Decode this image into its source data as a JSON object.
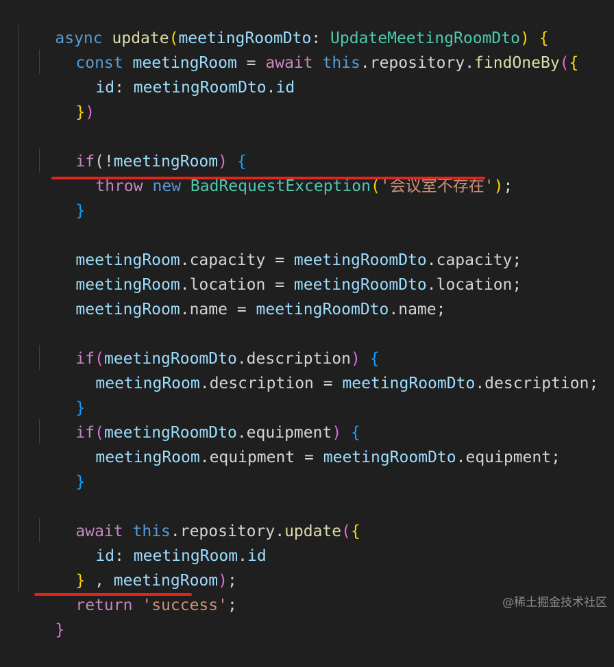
{
  "code": {
    "l1": [
      "async",
      "update",
      "(",
      "meetingRoomDto",
      ": ",
      "UpdateMeetingRoomDto",
      ")",
      " {"
    ],
    "l2": [
      "const",
      "meetingRoom",
      " = ",
      "await",
      "this",
      ".repository.",
      "findOneBy",
      "(",
      "{"
    ],
    "l3": [
      "id",
      ": ",
      "meetingRoomDto",
      ".",
      "id"
    ],
    "l4": [
      "}",
      ")"
    ],
    "l6": [
      "if",
      "(!",
      "meetingRoom",
      ")",
      " {"
    ],
    "l7": [
      "throw",
      "new",
      "BadRequestException",
      "(",
      "'会议室不存在'",
      ")",
      ";"
    ],
    "l8": [
      "}"
    ],
    "l10": [
      "meetingRoom",
      ".capacity",
      " = ",
      "meetingRoomDto",
      ".capacity",
      ";"
    ],
    "l11": [
      "meetingRoom",
      ".location",
      " = ",
      "meetingRoomDto",
      ".location",
      ";"
    ],
    "l12": [
      "meetingRoom",
      ".name",
      " = ",
      "meetingRoomDto",
      ".name",
      ";"
    ],
    "l14": [
      "if",
      "(",
      "meetingRoomDto",
      ".description",
      ")",
      " {"
    ],
    "l15": [
      "meetingRoom",
      ".description",
      " = ",
      "meetingRoomDto",
      ".description",
      ";"
    ],
    "l16": [
      "}"
    ],
    "l17": [
      "if",
      "(",
      "meetingRoomDto",
      ".equipment",
      ")",
      " {"
    ],
    "l18": [
      "meetingRoom",
      ".equipment",
      " = ",
      "meetingRoomDto",
      ".equipment",
      ";"
    ],
    "l19": [
      "}"
    ],
    "l21": [
      "await",
      "this",
      ".repository.",
      "update",
      "(",
      "{"
    ],
    "l22": [
      "id",
      ": ",
      "meetingRoom",
      ".",
      "id"
    ],
    "l23": [
      "}",
      " , ",
      "meetingRoom",
      ")",
      ";"
    ],
    "l24": [
      "return",
      "'success'",
      ";"
    ],
    "l25": [
      "}"
    ]
  },
  "watermark": "@稀土掘金技术社区",
  "colors": {
    "background": "#1f1f1f",
    "keyword": "#569cd6",
    "control": "#c586c0",
    "function": "#dcdcaa",
    "variable": "#9cdcfe",
    "type": "#4ec9b0",
    "string": "#ce9178",
    "annotation_underline": "#e8231b"
  }
}
